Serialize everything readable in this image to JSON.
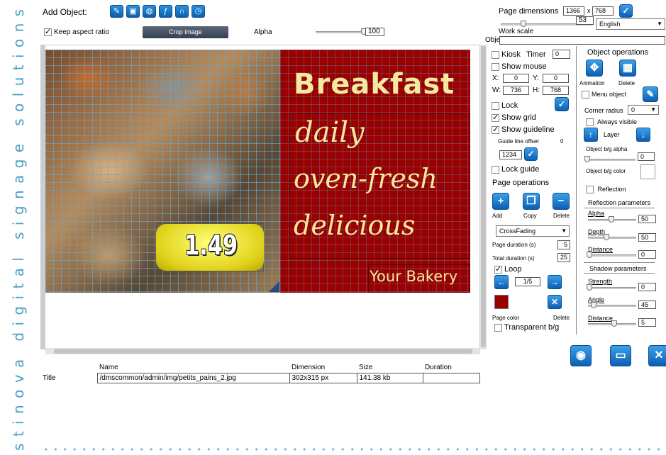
{
  "branding": {
    "vertical_text": "stinova digital signage solutions"
  },
  "toolbar": {
    "add_object_label": "Add Object:",
    "icons": [
      "text-icon",
      "image-icon",
      "web-icon",
      "flash-icon",
      "rss-icon",
      "clock-icon"
    ],
    "keep_aspect_label": "Keep aspect ratio",
    "keep_aspect_checked": true,
    "crop_label": "Crop image",
    "alpha_label": "Alpha",
    "alpha_value": "100"
  },
  "page_settings": {
    "dimensions_label": "Page dimensions",
    "width": "1366",
    "x_sep": "x",
    "height": "768",
    "work_scale_value": "53",
    "work_scale_label": "Work scale",
    "language": "English",
    "object_label": "Object",
    "object_value": ""
  },
  "canvas": {
    "heading": "Breakfast",
    "line1": "daily",
    "line2": "oven-fresh",
    "line3": "delicious",
    "price": "1.49",
    "footer": "Your Bakery",
    "bg_color": "#990000"
  },
  "page_panel": {
    "kiosk_label": "Kiosk",
    "timer_label": "Timer",
    "timer_value": "0",
    "show_mouse_label": "Show mouse",
    "x_label": "X:",
    "x_value": "0",
    "y_label": "Y:",
    "y_value": "0",
    "w_label": "W:",
    "w_value": "736",
    "h_label": "H:",
    "h_value": "768",
    "lock_label": "Lock",
    "show_grid_label": "Show grid",
    "show_guideline_label": "Show guideline",
    "guide_offset_label": "Guide line offset",
    "guide_offset_value": "0",
    "guide_pos_value": "1234",
    "lock_guide_label": "Lock guide",
    "page_ops_title": "Page operations",
    "add_label": "Add",
    "copy_label": "Copy",
    "delete_label": "Delete",
    "transition": "CrossFading",
    "page_duration_label": "Page duration (s)",
    "page_duration_value": "5",
    "total_duration_label": "Total duration (s)",
    "total_duration_value": "25",
    "loop_label": "Loop",
    "page_nav": "1/5",
    "page_color_label": "Page color",
    "page_color_delete_label": "Delete",
    "page_color": "#990000",
    "transparent_label": "Transparent b/g"
  },
  "object_panel": {
    "title": "Object operations",
    "animation_label": "Animation",
    "delete_label": "Delete",
    "menu_object_label": "Menu object",
    "corner_radius_label": "Corner radius",
    "corner_radius_value": "0",
    "always_visible_label": "Always visible",
    "layer_label": "Layer",
    "bg_alpha_label": "Object b/g alpha",
    "bg_alpha_value": "0",
    "bg_color_label": "Object b/g color",
    "reflection_label": "Reflection",
    "reflection_params_title": "Reflection parameters",
    "alpha_label": "Alpha",
    "alpha_value": "50",
    "depth_label": "Depth",
    "depth_value": "50",
    "distance_label": "Distance",
    "distance_value": "0",
    "shadow_params_title": "Shadow parameters",
    "strength_label": "Strength",
    "strength_value": "0",
    "angle_label": "Angle",
    "angle_value": "45",
    "shadow_distance_label": "Distance",
    "shadow_distance_value": "5"
  },
  "file_info": {
    "headers": [
      "Name",
      "Dimension",
      "Size",
      "Duration"
    ],
    "row_label": "Title",
    "name": "/dmscommon/admin/img/petits_pains_2.jpg",
    "dimension": "302x315 px",
    "size": "141.38 kb",
    "duration": ""
  }
}
